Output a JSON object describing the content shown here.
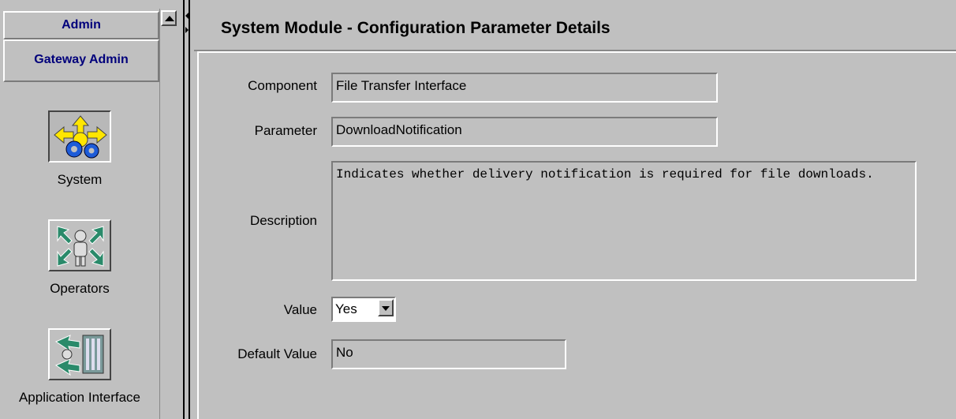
{
  "nav": {
    "tabs": [
      {
        "label": "Admin"
      },
      {
        "label": "Gateway Admin"
      }
    ],
    "items": [
      {
        "label": "System",
        "icon": "system-gears-icon",
        "selected": true
      },
      {
        "label": "Operators",
        "icon": "operators-person-icon",
        "selected": false
      },
      {
        "label": "Application Interface",
        "icon": "application-interface-icon",
        "selected": false
      }
    ]
  },
  "main": {
    "title": "System Module - Configuration Parameter Details",
    "fields": {
      "component": {
        "label": "Component",
        "value": "File Transfer Interface"
      },
      "parameter": {
        "label": "Parameter",
        "value": "DownloadNotification"
      },
      "description": {
        "label": "Description",
        "value": "Indicates whether delivery notification is required for file downloads."
      },
      "value": {
        "label": "Value",
        "selected": "Yes"
      },
      "default_value": {
        "label": "Default Value",
        "value": "No"
      }
    }
  },
  "colors": {
    "background": "#c0c0c0",
    "tab_text": "#00007b"
  }
}
